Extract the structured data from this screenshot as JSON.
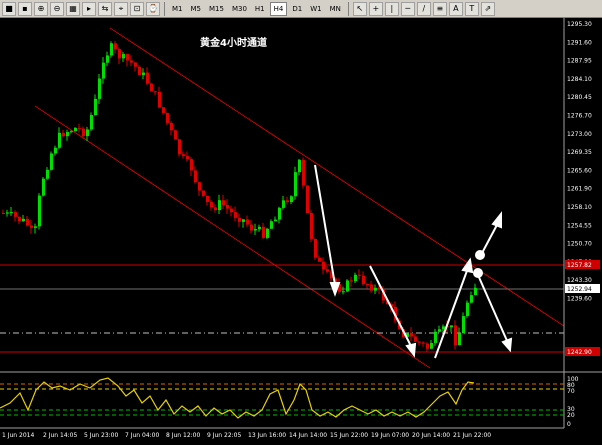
{
  "toolbar": {
    "buttons": [
      "■",
      "▪",
      "⊕",
      "⊖",
      "▦",
      "▸",
      "⇆",
      "⌖",
      "⊡",
      "⌚"
    ],
    "timeframes": [
      "M1",
      "M5",
      "M15",
      "M30",
      "H1",
      "H4",
      "D1",
      "W1",
      "MN"
    ],
    "active_timeframe": "H4",
    "tools": [
      "↖",
      "+",
      "|",
      "─",
      "/",
      "≡",
      "A",
      "T",
      "⇗"
    ]
  },
  "chart": {
    "title": "黄金4小时通道",
    "price_labels": [
      "1295.30",
      "1291.60",
      "1287.95",
      "1284.10",
      "1280.45",
      "1276.70",
      "1273.00",
      "1269.35",
      "1265.60",
      "1261.90",
      "1258.10",
      "1254.55",
      "1250.70",
      "1247.00",
      "1243.30",
      "1239.60"
    ],
    "current_price": "1252.94",
    "resistance_label": "1257.82",
    "support_label": "1242.90",
    "time_labels": [
      "1 Jun 2014",
      "2 Jun 14:05",
      "5 Jun 23:00",
      "7 Jun 04:00",
      "8 Jun 12:00",
      "9 Jun 22:05",
      "13 Jun 16:00",
      "14 Jun 14:00",
      "15 Jun 22:00",
      "19 Jun 07:00",
      "20 Jun 14:00",
      "21 Jun 22:00"
    ]
  },
  "indicator": {
    "levels": [
      "100",
      "80",
      "70",
      "30",
      "20",
      "0"
    ]
  },
  "colors": {
    "bull": "#00e000",
    "bear": "#e00000",
    "channel": "#d00000",
    "indicator": "#e8d000"
  }
}
